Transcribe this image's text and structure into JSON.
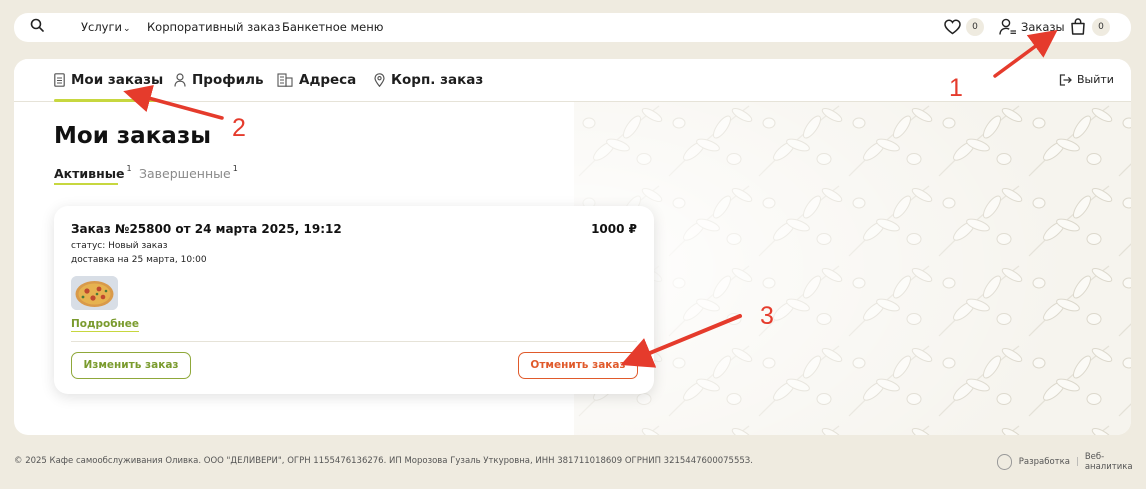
{
  "topbar": {
    "nav": {
      "services": "Услуги",
      "corporate": "Корпоративный заказ",
      "banquet": "Банкетное меню"
    },
    "favorites_count": "0",
    "orders_label": "Заказы",
    "cart_count": "0"
  },
  "account_tabs": [
    {
      "label": "Мои заказы",
      "icon": "document-icon"
    },
    {
      "label": "Профиль",
      "icon": "person-icon"
    },
    {
      "label": "Адреса",
      "icon": "building-icon"
    },
    {
      "label": "Корп. заказ",
      "icon": "location-pin-icon"
    }
  ],
  "logout_label": "Выйти",
  "page_title": "Мои заказы",
  "order_tabs": {
    "active": {
      "label": "Активные",
      "count": "1"
    },
    "completed": {
      "label": "Завершенные",
      "count": "1"
    }
  },
  "order": {
    "title": "Заказ №25800 от 24 марта 2025, 19:12",
    "price": "1000 ₽",
    "status": "статус: Новый заказ",
    "delivery": "доставка на 25 марта, 10:00",
    "more_label": "Подробнее",
    "edit_label": "Изменить заказ",
    "cancel_label": "Отменить заказ"
  },
  "annotations": [
    "1",
    "2",
    "3"
  ],
  "footer": {
    "copyright": "© 2025 Кафе самообслуживания Оливка. ООО \"ДЕЛИВЕРИ\", ОГРН 1155476136276. ИП Морозова Гузаль Уткуровна, ИНН 381711018609 ОГРНИП 321544760007555З.",
    "dev_label": "Разработка",
    "analytics_label": "Веб-аналитика"
  },
  "colors": {
    "accent_green": "#c7d73f",
    "link_green": "#7a9b2e",
    "cancel_orange": "#e05a2b",
    "annotation_red": "#e53b2c",
    "page_bg": "#efebe0"
  }
}
